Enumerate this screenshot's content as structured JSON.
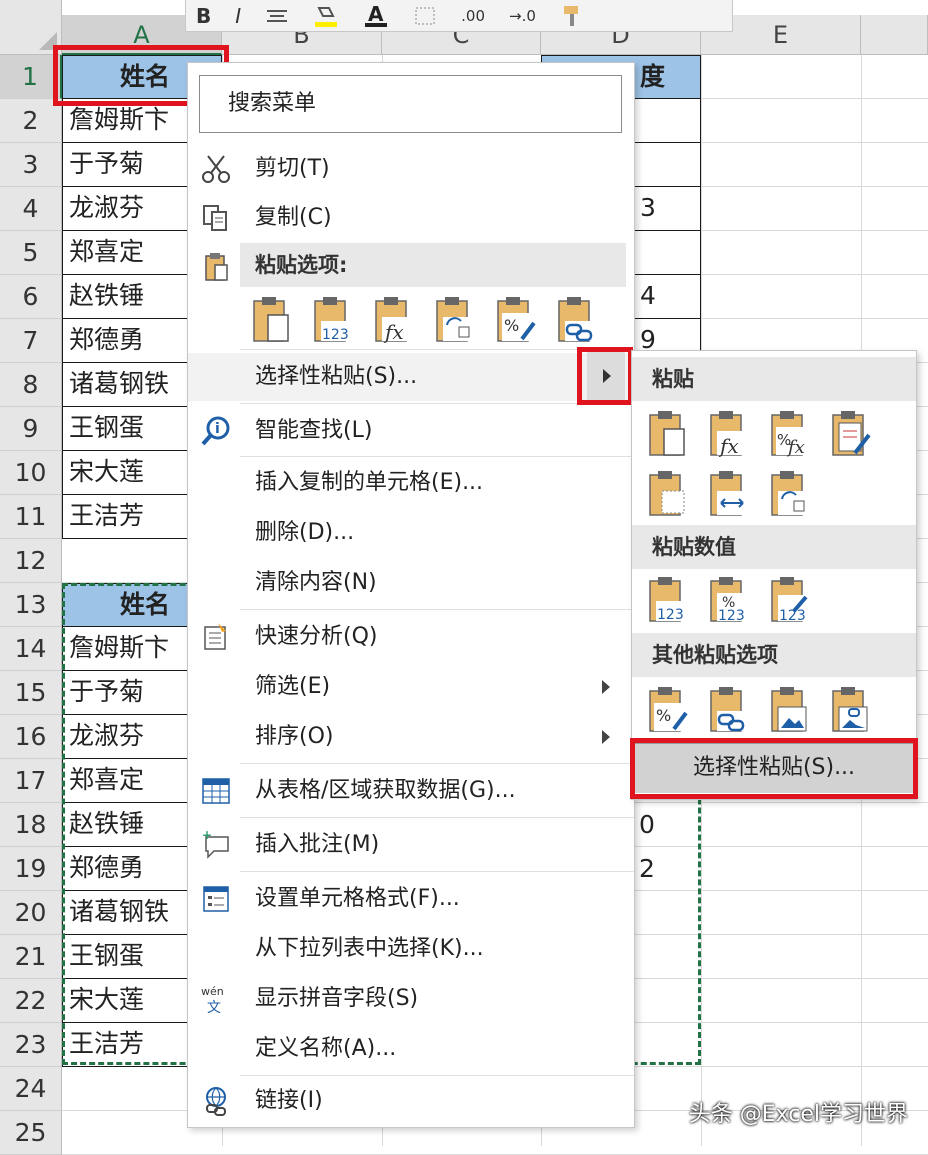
{
  "toolbar": {
    "bold": "B",
    "italic": "I",
    "decimal_increase": ".00",
    "decimal_decrease": "→.0"
  },
  "columns": [
    "A",
    "B",
    "C",
    "D",
    "E"
  ],
  "rows": [
    "1",
    "2",
    "3",
    "4",
    "5",
    "6",
    "7",
    "8",
    "9",
    "10",
    "11",
    "12",
    "13",
    "14",
    "15",
    "16",
    "17",
    "18",
    "19",
    "20",
    "21",
    "22",
    "23",
    "24",
    "25"
  ],
  "table1": {
    "header": "姓名",
    "names": [
      "詹姆斯卞",
      "于予菊",
      "龙淑芬",
      "郑喜定",
      "赵铁锤",
      "郑德勇",
      "诸葛钢铁",
      "王钢蛋",
      "宋大莲",
      "王洁芳"
    ]
  },
  "table2": {
    "header": "姓名",
    "names": [
      "詹姆斯卞",
      "于予菊",
      "龙淑芬",
      "郑喜定",
      "赵铁锤",
      "郑德勇",
      "诸葛钢铁",
      "王钢蛋",
      "宋大莲",
      "王洁芳"
    ]
  },
  "column_d_header": "度",
  "column_d_partial": {
    "r4": "3",
    "r6": "4",
    "r7": "9",
    "r18": "0",
    "r19": "2"
  },
  "context_menu": {
    "search_placeholder": "搜索菜单",
    "items": {
      "cut": "剪切(T)",
      "copy": "复制(C)",
      "paste_options": "粘贴选项:",
      "paste_special": "选择性粘贴(S)...",
      "smart_lookup": "智能查找(L)",
      "insert_copied": "插入复制的单元格(E)...",
      "delete": "删除(D)...",
      "clear": "清除内容(N)",
      "quick_analysis": "快速分析(Q)",
      "filter": "筛选(E)",
      "sort": "排序(O)",
      "get_data": "从表格/区域获取数据(G)...",
      "insert_comment": "插入批注(M)",
      "format_cells": "设置单元格格式(F)...",
      "pick_list": "从下拉列表中选择(K)...",
      "phonetic": "显示拼音字段(S)",
      "define_name": "定义名称(A)...",
      "link": "链接(I)"
    }
  },
  "submenu": {
    "paste": "粘贴",
    "paste_values": "粘贴数值",
    "other_paste": "其他粘贴选项",
    "paste_special": "选择性粘贴(S)..."
  },
  "watermark": "头条 @Excel学习世界",
  "colors": {
    "header_fill": "#9dc3e6",
    "highlight_red": "#e0141e",
    "excel_green": "#217346",
    "clipboard": "#e8b96a"
  }
}
